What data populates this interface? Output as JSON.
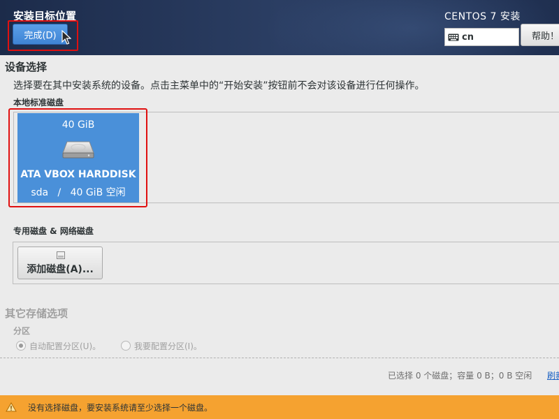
{
  "header": {
    "spoke_title": "安装目标位置",
    "done_button": "完成(D)",
    "product_title": "CENTOS 7 安装",
    "keyboard_layout": "cn",
    "help_button": "帮助！"
  },
  "device_selection": {
    "title": "设备选择",
    "description": "选择要在其中安装系统的设备。点击主菜单中的“开始安装”按钮前不会对该设备进行任何操作。",
    "local_disks_label": "本地标准磁盘",
    "disks": [
      {
        "size": "40 GiB",
        "name": "ATA VBOX HARDDISK",
        "device": "sda",
        "separator": "/",
        "free": "40 GiB 空闲",
        "selected": true
      }
    ],
    "specialized_label": "专用磁盘 & 网络磁盘",
    "add_disk_button": "添加磁盘(A)..."
  },
  "other_storage": {
    "title": "其它存储选项",
    "partitioning_label": "分区",
    "options": [
      {
        "label": "自动配置分区(U)。",
        "checked": true
      },
      {
        "label": "我要配置分区(I)。",
        "checked": false
      }
    ]
  },
  "footer": {
    "summary": "已选择 0 个磁盘；容量 0 B；0 B 空闲",
    "refresh_link": "刷新"
  },
  "warning": {
    "text": "没有选择磁盘，要安装系统请至少选择一个磁盘。",
    "color": "#f5a230"
  },
  "colors": {
    "header": "#1c2b4a",
    "accent": "#4a90d9",
    "highlight": "#e01010"
  }
}
